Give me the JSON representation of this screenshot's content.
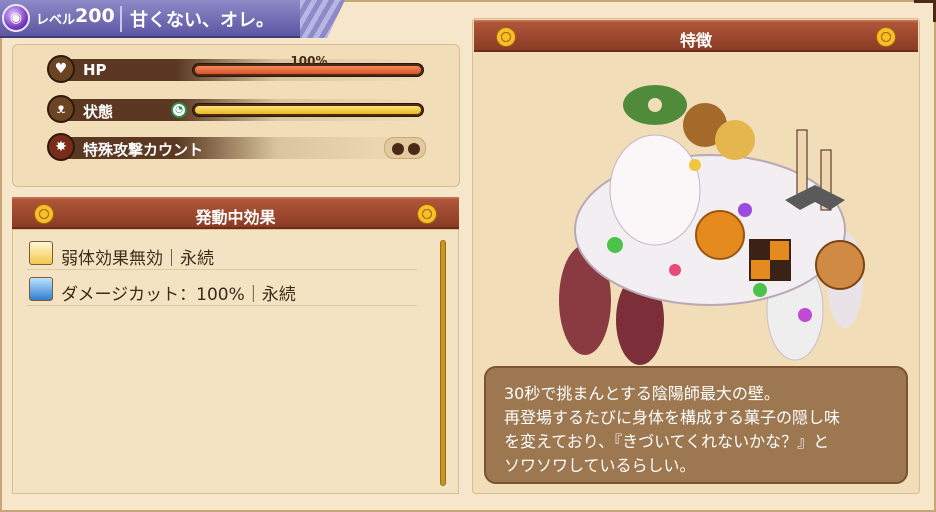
{
  "header": {
    "level_label": "レベル",
    "level_value": "200",
    "boss_name": "甘くない、オレ。"
  },
  "status": {
    "hp_label": "HP",
    "hp_percent_text": "100%",
    "hp_fill": 1.0,
    "state_label": "状態",
    "state_fill": 1.0,
    "special_label": "特殊攻撃カウント",
    "special_count_total": 2
  },
  "effects": {
    "title": "発動中効果",
    "items": [
      {
        "text": "弱体効果無効｜永続",
        "icon": "debuff-immunity-icon"
      },
      {
        "text": "ダメージカット：100%｜永続",
        "icon": "damage-cut-icon"
      }
    ]
  },
  "feature": {
    "title": "特徴",
    "description": [
      "30秒で挑まんとする陰陽師最大の壁。",
      "再登場するたびに身体を構成する菓子の隠し味",
      "を変えており、『きづいてくれないかな？』と",
      "ソワソワしているらしい。"
    ]
  },
  "colors": {
    "section_bar": "#9a4329",
    "hp_bar": "#e86a3c",
    "state_bar": "#f3cf45",
    "banner": "#6e68b3"
  }
}
